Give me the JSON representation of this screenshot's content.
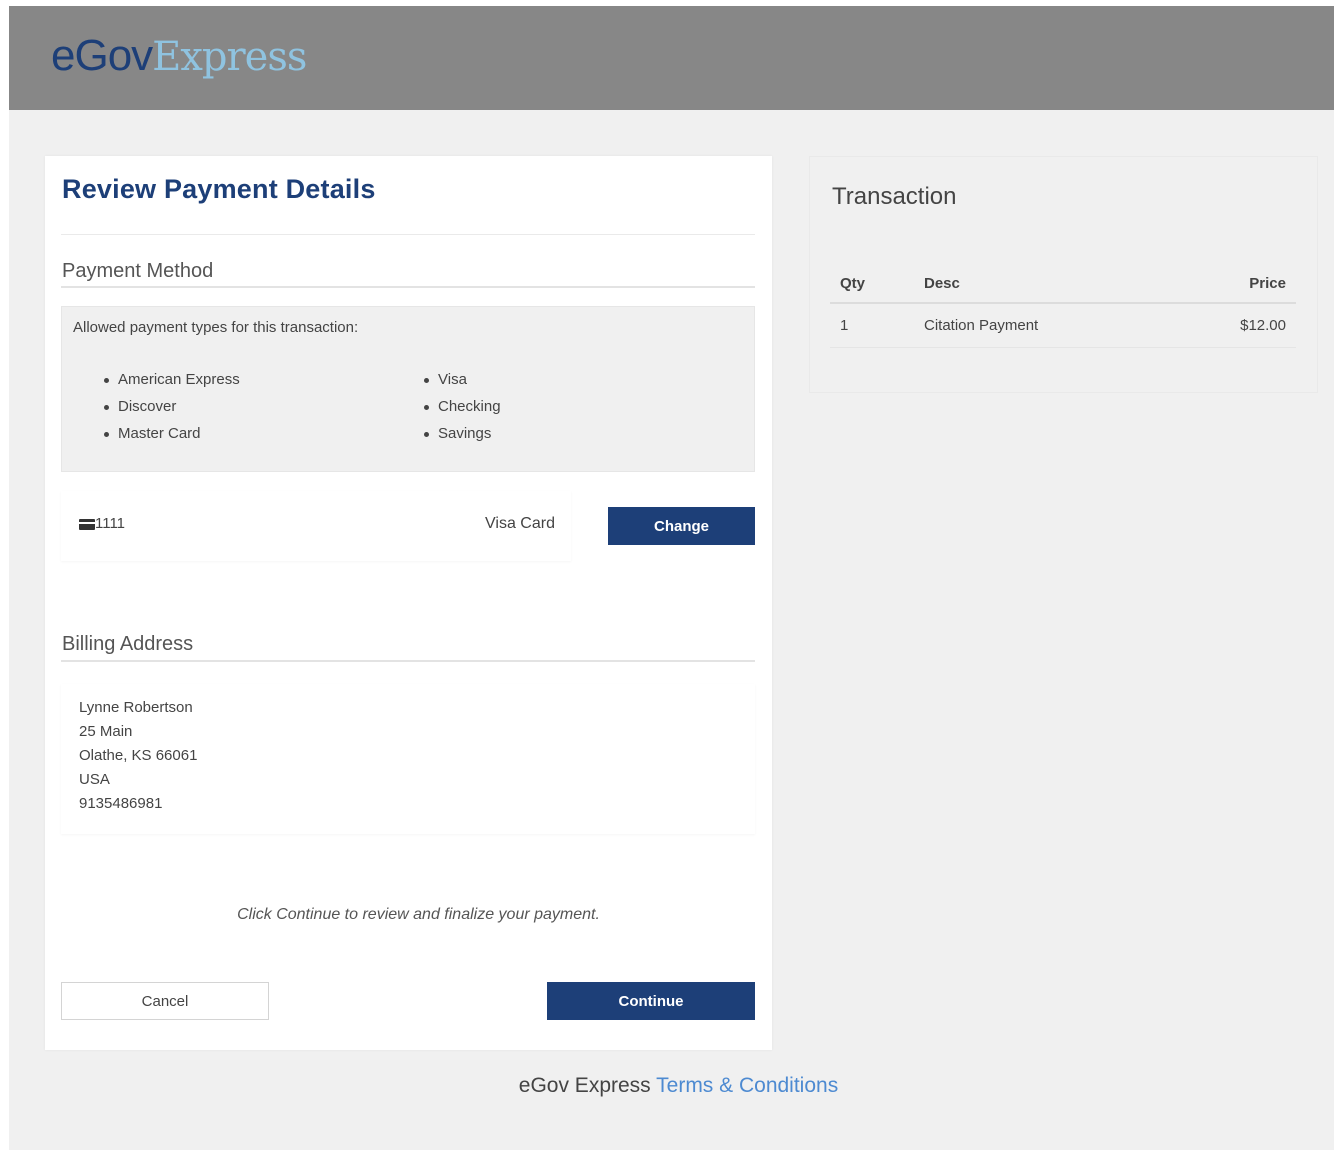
{
  "header": {
    "logo_part1": "eGov",
    "logo_part2": "Express"
  },
  "review": {
    "title": "Review Payment Details",
    "payment_method": {
      "heading": "Payment Method",
      "allowed_intro": "Allowed payment types for this transaction:",
      "types_col1": [
        "American Express",
        "Discover",
        "Master Card"
      ],
      "types_col2": [
        "Visa",
        "Checking",
        "Savings"
      ],
      "card_number": "1111",
      "card_type": "Visa Card",
      "change_label": "Change",
      "card_icon": "credit-card-icon"
    },
    "billing": {
      "heading": "Billing Address",
      "name": "Lynne Robertson",
      "street": "25 Main",
      "city_state_zip": "Olathe, KS 66061",
      "country": "USA",
      "phone": "9135486981"
    },
    "hint": "Click Continue to review and finalize your payment.",
    "cancel_label": "Cancel",
    "continue_label": "Continue"
  },
  "transaction": {
    "title": "Transaction",
    "columns": [
      "Qty",
      "Desc",
      "Price"
    ],
    "rows": [
      {
        "qty": "1",
        "desc": "Citation Payment",
        "price": "$12.00"
      }
    ]
  },
  "footer": {
    "brand": "eGov Express",
    "link_label": "Terms & Conditions"
  },
  "colors": {
    "header_bg": "#878787",
    "brand_navy": "#1d3f78",
    "brand_light_blue": "#8fc3e0",
    "link_blue": "#4d8ad1"
  }
}
